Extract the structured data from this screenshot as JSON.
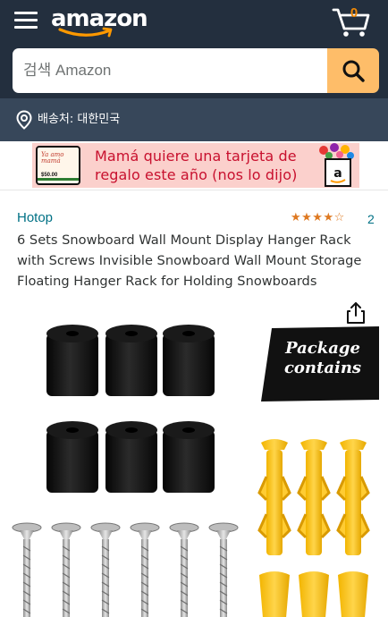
{
  "header": {
    "logo": "amazon",
    "cart_count": "0",
    "icons": {
      "menu": "hamburger-menu-icon",
      "cart": "shopping-cart-icon",
      "search": "search-icon",
      "location": "location-pin-icon"
    },
    "colors": {
      "nav_bg": "#232f3e",
      "location_bg": "#37475a",
      "search_button": "#febd69",
      "cart_count": "#f08804"
    }
  },
  "search": {
    "placeholder": "검색 Amazon"
  },
  "location": {
    "label": "배송처: 대한민국"
  },
  "banner": {
    "line1": "Mamá quiere una tarjeta de",
    "line2": "regalo este año (nos lo dijo)",
    "card_text": "Ya amo mamá",
    "card_amount": "$50.00",
    "text_color": "#c8102e",
    "bg_color": "#fbd0cc"
  },
  "product": {
    "brand": "Hotop",
    "rating_stars": "★★★★☆",
    "rating_value": 4,
    "rating_count": "2",
    "title": "6 Sets Snowboard Wall Mount Display Hanger Rack with Screws Invisible Snowboard Wall Mount Storage Floating Hanger Rack for Holding Snowboards",
    "image_tag": "Package contains",
    "share_icon": "share-icon",
    "link_color": "#007185",
    "star_color": "#de7921"
  }
}
